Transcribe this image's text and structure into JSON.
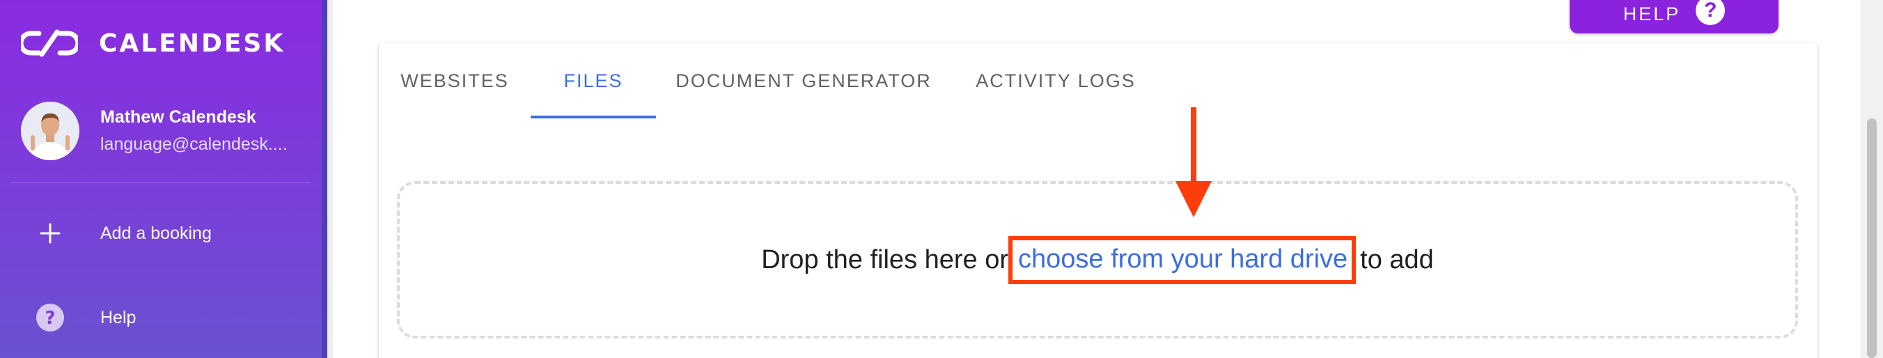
{
  "sidebar": {
    "brand_name": "CALENDESK",
    "profile": {
      "name": "Mathew Calendesk",
      "email": "language@calendesk...."
    },
    "items": [
      {
        "label": "Add a booking",
        "icon": "plus-icon"
      },
      {
        "label": "Help",
        "icon": "help-circle-icon"
      }
    ]
  },
  "header": {
    "help_label": "HELP",
    "help_icon_glyph": "?"
  },
  "tabs": [
    {
      "label": "WEBSITES",
      "active": false
    },
    {
      "label": "FILES",
      "active": true
    },
    {
      "label": "DOCUMENT GENERATOR",
      "active": false
    },
    {
      "label": "ACTIVITY LOGS",
      "active": false
    }
  ],
  "dropzone": {
    "text_before": "Drop the files here or",
    "link_text": "choose from your hard drive",
    "text_after": "to add"
  },
  "colors": {
    "sidebar_top": "#8a2be2",
    "sidebar_bottom": "#6a52d0",
    "accent_blue": "#3c6ee0",
    "help_purple": "#8b22dd",
    "highlight_red": "#ff3d0a"
  }
}
